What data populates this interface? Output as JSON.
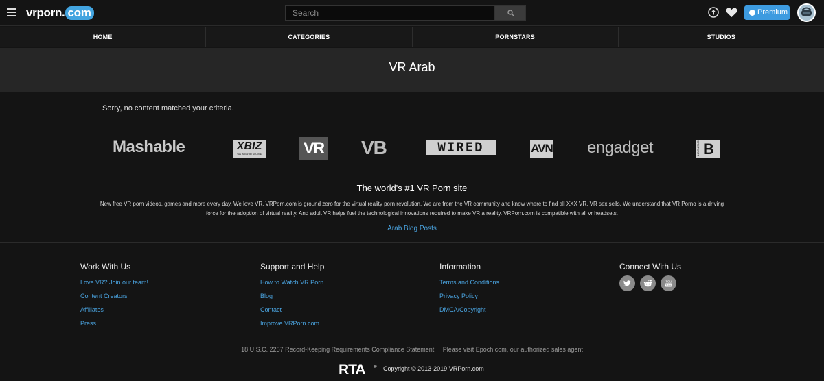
{
  "header": {
    "logo_main": "vrporn",
    "logo_dot": ".",
    "logo_com": "com",
    "search_placeholder": "Search",
    "premium_label": "Premium"
  },
  "nav": {
    "items": [
      {
        "label": "HOME"
      },
      {
        "label": "CATEGORIES"
      },
      {
        "label": "PORNSTARS"
      },
      {
        "label": "STUDIOS"
      }
    ]
  },
  "page": {
    "title": "VR Arab",
    "empty_message": "Sorry, no content matched your criteria."
  },
  "press_logos": [
    {
      "name": "Mashable",
      "text": "Mashable"
    },
    {
      "name": "XBIZ",
      "text": "XBIZ",
      "subtext": "THE INDUSTRY SOURCE"
    },
    {
      "name": "VR",
      "text": "VR"
    },
    {
      "name": "VB",
      "text": "VB"
    },
    {
      "name": "WIRED",
      "text": "WIRED"
    },
    {
      "name": "AVN",
      "text": "AVN"
    },
    {
      "name": "engadget",
      "text": "engadget"
    },
    {
      "name": "Breitbart",
      "text": "B",
      "subtext": "BREITBART"
    }
  ],
  "about": {
    "tagline": "The world's #1 VR Porn site",
    "description": "New free VR porn videos, games and more every day. We love VR. VRPorn.com is ground zero for the virtual reality porn revolution. We are from the VR community and know where to find all XXX VR. VR sex sells. We understand that VR Porno is a driving force for the adoption of virtual reality. And adult VR helps fuel the technological innovations required to make VR a reality. VRPorn.com is compatible with all vr headsets.",
    "blog_link": "Arab Blog Posts"
  },
  "footer": {
    "columns": [
      {
        "heading": "Work With Us",
        "links": [
          "Love VR? Join our team!",
          "Content Creators",
          "Affiliates",
          "Press"
        ]
      },
      {
        "heading": "Support and Help",
        "links": [
          "How to Watch VR Porn",
          "Blog",
          "Contact",
          "Improve VRPorn.com"
        ]
      },
      {
        "heading": "Information",
        "links": [
          "Terms and Conditions",
          "Privacy Policy",
          "DMCA/Copyright"
        ]
      },
      {
        "heading": "Connect With Us",
        "social": [
          "twitter-icon",
          "reddit-icon",
          "youtube-icon"
        ]
      }
    ],
    "compliance_statement": "18 U.S.C. 2257 Record-Keeping Requirements Compliance Statement",
    "epoch_notice": "Please visit Epoch.com, our authorized sales agent",
    "rta_label": "RTA",
    "copyright": "Copyright © 2013-2019 VRPorn.com"
  },
  "colors": {
    "accent": "#42a4e0",
    "link": "#4aa3df",
    "background": "#141414",
    "title_band": "#262626"
  }
}
